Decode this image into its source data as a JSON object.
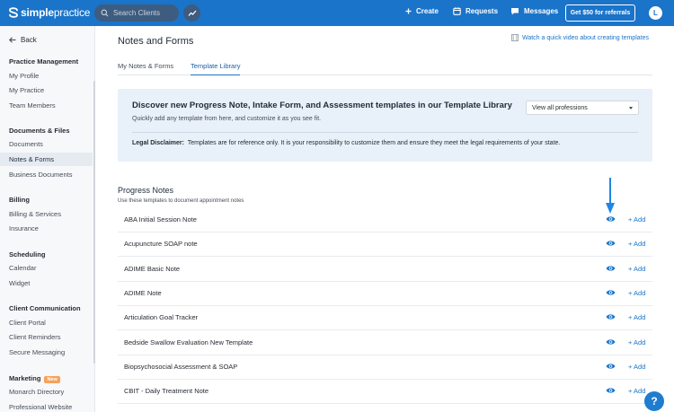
{
  "header": {
    "logo_bold": "simple",
    "logo_light": "practice",
    "search_placeholder": "Search Clients",
    "nav": [
      {
        "label": "Create",
        "icon": "plus-icon"
      },
      {
        "label": "Requests",
        "icon": "calendar-icon"
      },
      {
        "label": "Messages",
        "icon": "chat-icon"
      }
    ],
    "referral_label": "Get $50 for referrals",
    "avatar_initial": "L"
  },
  "sidebar": {
    "back_label": "Back",
    "sections": [
      {
        "title": "Practice Management",
        "items": [
          "My Profile",
          "My Practice",
          "Team Members"
        ]
      },
      {
        "title": "Documents & Files",
        "items": [
          "Documents",
          "Notes & Forms",
          "Business Documents"
        ]
      },
      {
        "title": "Billing",
        "items": [
          "Billing & Services",
          "Insurance"
        ]
      },
      {
        "title": "Scheduling",
        "items": [
          "Calendar",
          "Widget"
        ]
      },
      {
        "title": "Client Communication",
        "items": [
          "Client Portal",
          "Client Reminders",
          "Secure Messaging"
        ]
      },
      {
        "title": "Marketing",
        "badge": "New",
        "items": [
          "Monarch Directory",
          "Professional Website"
        ]
      }
    ],
    "active_item": "Notes & Forms"
  },
  "main": {
    "title": "Notes and Forms",
    "video_link": "Watch a quick video about creating templates",
    "tabs": [
      {
        "label": "My Notes & Forms",
        "active": false
      },
      {
        "label": "Template Library",
        "active": true
      }
    ],
    "banner": {
      "title": "Discover new Progress Note, Intake Form, and Assessment templates in our Template Library",
      "subtitle": "Quickly add any template from here, and customize it as you see fit.",
      "select_value": "View all professions",
      "disclaimer_label": "Legal Disclaimer:",
      "disclaimer_text": "Templates are for reference only. It is your responsibility to customize them and ensure they meet the legal requirements of your state."
    },
    "progress_notes": {
      "title": "Progress Notes",
      "subtitle": "Use these templates to document appointment notes",
      "add_label": "+ Add",
      "rows": [
        "ABA Initial Session Note",
        "Acupuncture SOAP note",
        "ADIME Basic Note",
        "ADIME Note",
        "Articulation Goal Tracker",
        "Bedside Swallow Evaluation New Template",
        "Biopsychosocial Assessment & SOAP",
        "CBIT - Daily Treatment Note"
      ]
    }
  },
  "help_label": "?",
  "colors": {
    "brand_blue": "#1a74c9",
    "banner_bg": "#e8f0f9",
    "badge_orange": "#f5a25c"
  }
}
